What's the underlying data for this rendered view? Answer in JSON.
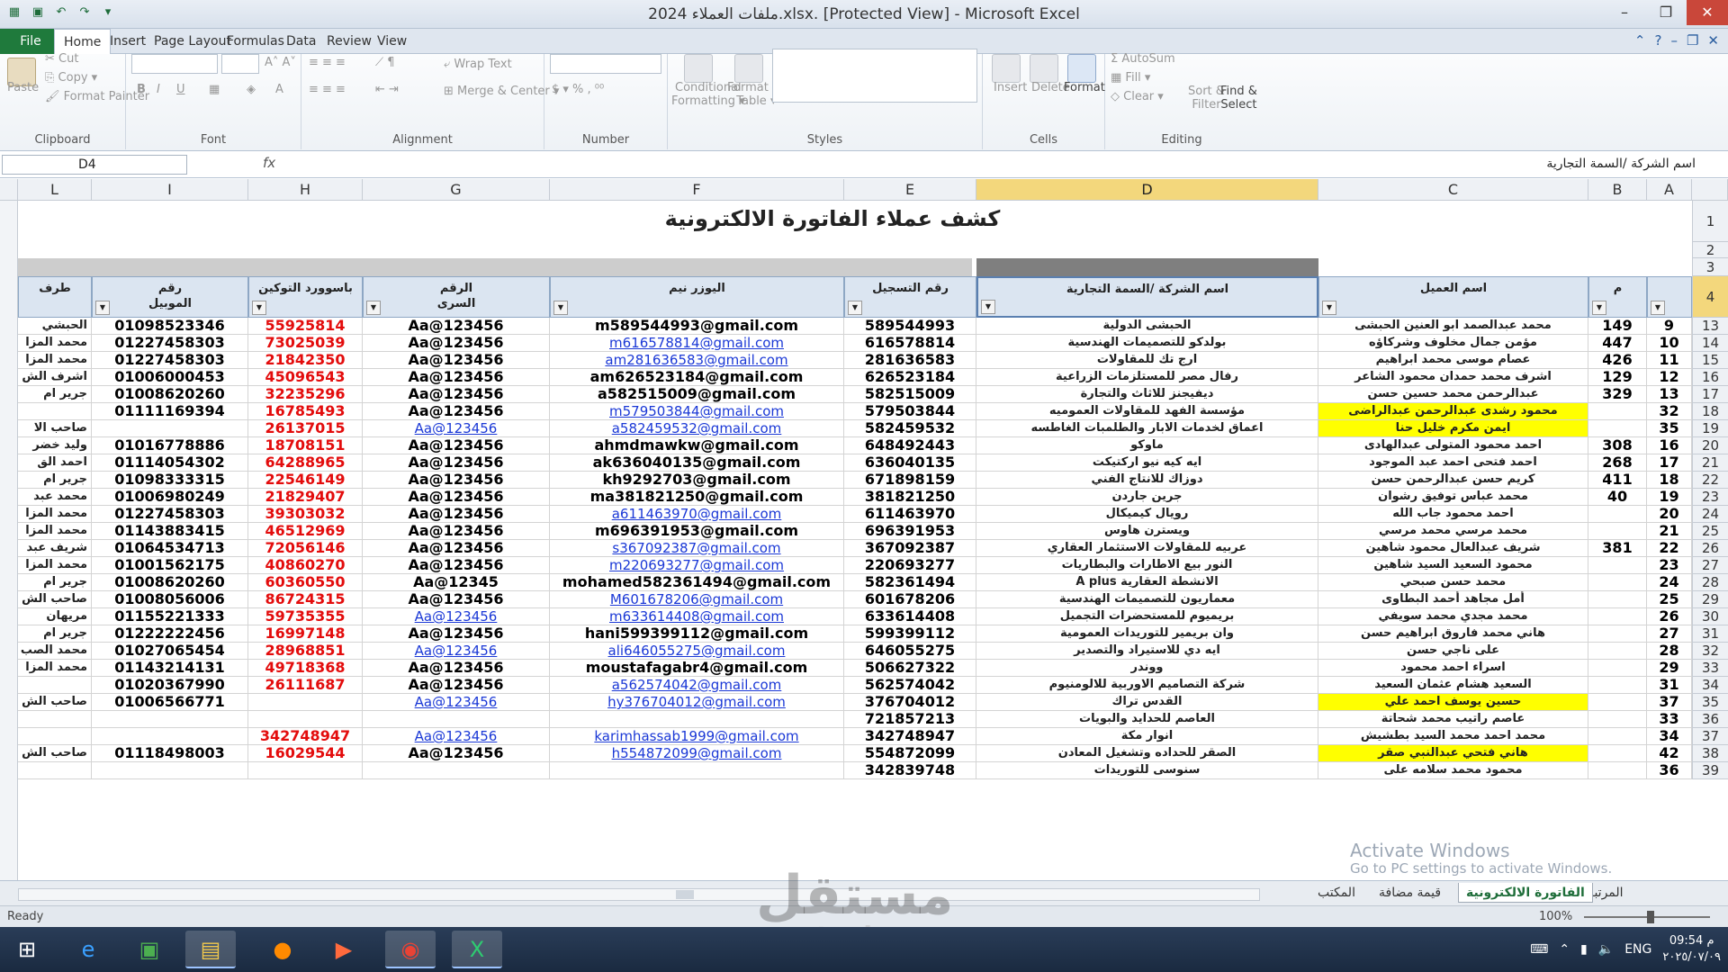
{
  "window": {
    "title": "ملفات العملاء 2024.xlsx.  [Protected View]  -  Microsoft Excel"
  },
  "tabs": [
    "File",
    "Home",
    "Insert",
    "Page Layout",
    "Formulas",
    "Data",
    "Review",
    "View"
  ],
  "ribbon": {
    "clipboard": {
      "label": "Clipboard",
      "paste": "Paste",
      "cut": "Cut",
      "copy": "Copy",
      "format_painter": "Format Painter"
    },
    "font": {
      "label": "Font"
    },
    "alignment": {
      "label": "Alignment",
      "wrap_text": "Wrap Text",
      "merge_center": "Merge & Center"
    },
    "number": {
      "label": "Number"
    },
    "styles": {
      "label": "Styles",
      "conditional": "Conditional",
      "formatting": "Formatting",
      "format_as": "Format as",
      "table": "Table"
    },
    "cells": {
      "label": "Cells",
      "insert": "Insert",
      "delete": "Delete",
      "format": "Format"
    },
    "editing": {
      "label": "Editing",
      "autosum": "AutoSum",
      "fill": "Fill",
      "clear": "Clear",
      "sort": "Sort &",
      "filter": "Filter",
      "find": "Find &",
      "select": "Select"
    }
  },
  "formula_bar": {
    "cell_ref": "D4",
    "fx": "fx",
    "content": "اسم الشركة /السمة التجارية"
  },
  "columns": [
    {
      "letter": "L",
      "sel": false
    },
    {
      "letter": "I",
      "sel": false
    },
    {
      "letter": "H",
      "sel": false
    },
    {
      "letter": "G",
      "sel": false
    },
    {
      "letter": "F",
      "sel": false
    },
    {
      "letter": "E",
      "sel": false
    },
    {
      "letter": "D",
      "sel": true
    },
    {
      "letter": "C",
      "sel": false
    },
    {
      "letter": "B",
      "sel": false
    },
    {
      "letter": "A",
      "sel": false
    }
  ],
  "sheet_title": "كشف عملاء الفاتورة الالكترونية",
  "headers": {
    "L": "طرف",
    "I": "رقم\nالموبيل",
    "H": "باسوورد التوكين",
    "G": "الرقم\nالسرى",
    "F": "اليوزر نيم",
    "E": "رقم التسجيل",
    "D": "اسم الشركة /السمة التجارية",
    "C": "اسم العميل",
    "B": "م"
  },
  "row_numbers": {
    "r1": "1",
    "r2": "2",
    "r3": "3",
    "r4": "4"
  },
  "rows": [
    {
      "rn": "13",
      "A": "9",
      "B": "149",
      "C": "محمد عبدالصمد ابو العنين الحبشى",
      "D": "الحبشى الدولية",
      "E": "589544993",
      "F": "m589544993@gmail.com",
      "Fl": false,
      "G": "Aa@123456",
      "Gl": false,
      "H": "55925814",
      "I": "01098523346",
      "L": "الحبشي",
      "Cy": false
    },
    {
      "rn": "14",
      "A": "10",
      "B": "447",
      "C": "مؤمن جمال مخلوف وشركاؤه",
      "D": "بولدكو للتصميمات الهندسية",
      "E": "616578814",
      "F": "m616578814@gmail.com",
      "Fl": true,
      "G": "Aa@123456",
      "Gl": false,
      "H": "73025039",
      "I": "01227458303",
      "L": "محمد المزا",
      "Cy": false
    },
    {
      "rn": "15",
      "A": "11",
      "B": "426",
      "C": "عصام موسى محمد ابراهيم",
      "D": "ارج تك للمقاولات",
      "E": "281636583",
      "F": "am281636583@gmail.com",
      "Fl": true,
      "G": "Aa@123456",
      "Gl": false,
      "H": "21842350",
      "I": "01227458303",
      "L": "محمد المزا",
      "Cy": false
    },
    {
      "rn": "16",
      "A": "12",
      "B": "129",
      "C": "اشرف محمد حمدان محمود الشاعر",
      "D": "رفال مصر للمستلزمات الزراعية",
      "E": "626523184",
      "F": "am626523184@gmail.com",
      "Fl": false,
      "G": "Aa@123456",
      "Gl": false,
      "H": "45096543",
      "I": "01006000453",
      "L": "اشرف الش",
      "Cy": false
    },
    {
      "rn": "17",
      "A": "13",
      "B": "329",
      "C": "عبدالرحمن محمد حسين حسن",
      "D": "ديفيجنز للاثاث والتجارة",
      "E": "582515009",
      "F": "a582515009@gmail.com",
      "Fl": false,
      "G": "Aa@123456",
      "Gl": false,
      "H": "32235296",
      "I": "01008620260",
      "L": "جرير ام",
      "Cy": false
    },
    {
      "rn": "18",
      "A": "32",
      "B": "",
      "C": "محمود رشدى عبدالرحمن عبدالراضى",
      "D": "مؤسسة الفهد للمقاولات العموميه",
      "E": "579503844",
      "F": "m579503844@gmail.com",
      "Fl": true,
      "G": "Aa@123456",
      "Gl": false,
      "H": "16785493",
      "I": "01111169394",
      "L": "",
      "Cy": true
    },
    {
      "rn": "19",
      "A": "35",
      "B": "",
      "C": "ايمن مكرم خليل حنا",
      "D": "اعماق لخدمات الابار والطلمبات الغاطسه",
      "E": "582459532",
      "F": "a582459532@gmail.com",
      "Fl": true,
      "G": "Aa@123456",
      "Gl": true,
      "H": "26137015",
      "I": "",
      "L": "صاحب الا",
      "Cy": true
    },
    {
      "rn": "20",
      "A": "16",
      "B": "308",
      "C": "احمد محمود المتولى عبدالهادى",
      "D": "ماوكو",
      "E": "648492443",
      "F": "ahmdmawkw@gmail.com",
      "Fl": false,
      "G": "Aa@123456",
      "Gl": false,
      "H": "18708151",
      "I": "01016778886",
      "L": "وليد خضر",
      "Cy": false
    },
    {
      "rn": "21",
      "A": "17",
      "B": "268",
      "C": "احمد فتحى احمد عبد الموجود",
      "D": "ايه كيه نيو اركتيكت",
      "E": "636040135",
      "F": "ak636040135@gmail.com",
      "Fl": false,
      "G": "Aa@123456",
      "Gl": false,
      "H": "64288965",
      "I": "01114054302",
      "L": "احمد الق",
      "Cy": false
    },
    {
      "rn": "22",
      "A": "18",
      "B": "411",
      "C": "كريم حسن عبدالرحمن حسن",
      "D": "دوزاك للانتاج الفني",
      "E": "671898159",
      "F": "kh9292703@gmail.com",
      "Fl": false,
      "G": "Aa@123456",
      "Gl": false,
      "H": "22546149",
      "I": "01098333315",
      "L": "جرير ام",
      "Cy": false
    },
    {
      "rn": "23",
      "A": "19",
      "B": "40",
      "C": "محمد عباس توفيق رشوان",
      "D": "جرين جاردن",
      "E": "381821250",
      "F": "ma381821250@gmail.com",
      "Fl": false,
      "G": "Aa@123456",
      "Gl": false,
      "H": "21829407",
      "I": "01006980249",
      "L": "محمد عبد",
      "Cy": false
    },
    {
      "rn": "24",
      "A": "20",
      "B": "",
      "C": "احمد محمود جاب الله",
      "D": "رويال كيميكال",
      "E": "611463970",
      "F": "a611463970@gmail.com",
      "Fl": true,
      "G": "Aa@123456",
      "Gl": false,
      "H": "39303032",
      "I": "01227458303",
      "L": "محمد المزا",
      "Cy": false
    },
    {
      "rn": "25",
      "A": "21",
      "B": "",
      "C": "محمد مرسي محمد مرسي",
      "D": "ويسترن هاوس",
      "E": "696391953",
      "F": "m696391953@gmail.com",
      "Fl": false,
      "G": "Aa@123456",
      "Gl": false,
      "H": "46512969",
      "I": "01143883415",
      "L": "محمد المزا",
      "Cy": false
    },
    {
      "rn": "26",
      "A": "22",
      "B": "381",
      "C": "شريف عبدالعال محمود شاهين",
      "D": "عربيه للمقاولات الاستثمار العقاري",
      "E": "367092387",
      "F": "s367092387@gmail.com",
      "Fl": true,
      "G": "Aa@123456",
      "Gl": false,
      "H": "72056146",
      "I": "01064534713",
      "L": "شريف عبد",
      "Cy": false
    },
    {
      "rn": "27",
      "A": "23",
      "B": "",
      "C": "محمود السعيد السيد شاهين",
      "D": "النور بيع الاطارات والبطاريات",
      "E": "220693277",
      "F": "m220693277@gmail.com",
      "Fl": true,
      "G": "Aa@123456",
      "Gl": false,
      "H": "40860270",
      "I": "01001562175",
      "L": "محمد المزا",
      "Cy": false
    },
    {
      "rn": "28",
      "A": "24",
      "B": "",
      "C": "محمد حسن صبحي",
      "D": "الانشطة العقارية A plus",
      "E": "582361494",
      "F": "mohamed582361494@gmail.com",
      "Fl": false,
      "G": "Aa@12345",
      "Gl": false,
      "H": "60360550",
      "I": "01008620260",
      "L": "جرير ام",
      "Cy": false
    },
    {
      "rn": "29",
      "A": "25",
      "B": "",
      "C": "أمل مجاهد أحمد البطاوى",
      "D": "معماريون للتصميمات الهندسية",
      "E": "601678206",
      "F": "M601678206@gmail.com",
      "Fl": true,
      "G": "Aa@123456",
      "Gl": false,
      "H": "86724315",
      "I": "01008056006",
      "L": "صاحب الش",
      "Cy": false
    },
    {
      "rn": "30",
      "A": "26",
      "B": "",
      "C": "محمد مجدي محمد سويفي",
      "D": "بريميوم للمستحضرات التجميل",
      "E": "633614408",
      "F": "m633614408@gmail.com",
      "Fl": true,
      "G": "Aa@123456",
      "Gl": true,
      "H": "59735355",
      "I": "01155221333",
      "L": "مريهان",
      "Cy": false
    },
    {
      "rn": "31",
      "A": "27",
      "B": "",
      "C": "هاني محمد فاروق ابراهيم حسن",
      "D": "وان بريمير للتوريدات العمومية",
      "E": "599399112",
      "F": "hani599399112@gmail.com",
      "Fl": false,
      "G": "Aa@123456",
      "Gl": false,
      "H": "16997148",
      "I": "01222222456",
      "L": "جرير ام",
      "Cy": false
    },
    {
      "rn": "32",
      "A": "28",
      "B": "",
      "C": "على ناجي حسن",
      "D": "ايه دي للاستيراد والتصدير",
      "E": "646055275",
      "F": "ali646055275@gmail.com",
      "Fl": true,
      "G": "Aa@123456",
      "Gl": true,
      "H": "28968851",
      "I": "01027065454",
      "L": "محمد الصب",
      "Cy": false
    },
    {
      "rn": "33",
      "A": "29",
      "B": "",
      "C": "اسراء احمد محمود",
      "D": "ووندر",
      "E": "506627322",
      "F": "moustafagabr4@gmail.com",
      "Fl": false,
      "G": "Aa@123456",
      "Gl": false,
      "H": "49718368",
      "I": "01143214131",
      "L": "محمد المزا",
      "Cy": false
    },
    {
      "rn": "34",
      "A": "31",
      "B": "",
      "C": "السعيد هشام عثمان السعيد",
      "D": "شركة التصاميم الاوربية للالومنيوم",
      "E": "562574042",
      "F": "a562574042@gmail.com",
      "Fl": true,
      "G": "Aa@123456",
      "Gl": false,
      "H": "26111687",
      "I": "01020367990",
      "L": "",
      "Cy": false
    },
    {
      "rn": "35",
      "A": "37",
      "B": "",
      "C": "حسين يوسف احمد علي",
      "D": "القدس تراك",
      "E": "376704012",
      "F": "hy376704012@gmail.com",
      "Fl": true,
      "G": "Aa@123456",
      "Gl": true,
      "H": "",
      "I": "01006566771",
      "L": "صاحب الش",
      "Cy": true
    },
    {
      "rn": "36",
      "A": "33",
      "B": "",
      "C": "عاصم راتيب محمد شحاتة",
      "D": "العاصم للحدايد والبويات",
      "E": "721857213",
      "F": "",
      "Fl": false,
      "G": "",
      "Gl": false,
      "H": "",
      "I": "",
      "L": "",
      "Cy": false
    },
    {
      "rn": "37",
      "A": "34",
      "B": "",
      "C": "محمد احمد محمد السيد بطشيش",
      "D": "انوار مكة",
      "E": "342748947",
      "F": "karimhassab1999@gmail.com",
      "Fl": true,
      "G": "Aa@123456",
      "Gl": true,
      "H": "342748947",
      "I": "",
      "L": "",
      "Cy": false
    },
    {
      "rn": "38",
      "A": "42",
      "B": "",
      "C": "هاني فتحي عبدالنبي صقر",
      "D": "الصقر للحداده وتشغيل المعادن",
      "E": "554872099",
      "F": "h554872099@gmail.com",
      "Fl": true,
      "G": "Aa@123456",
      "Gl": false,
      "H": "16029544",
      "I": "01118498003",
      "L": "صاحب الش",
      "Cy": true
    },
    {
      "rn": "39",
      "A": "36",
      "B": "",
      "C": "محمود محمد سلامه على",
      "D": "سنوسى للتوريدات",
      "E": "342839748",
      "F": "",
      "Fl": false,
      "G": "",
      "Gl": false,
      "H": "",
      "I": "",
      "L": "",
      "Cy": false
    }
  ],
  "sheet_tabs": [
    "المرتبات",
    "الفاتورة الالكترونية",
    "قيمة مضافة",
    "المكتب"
  ],
  "status": {
    "ready": "Ready",
    "zoom": "100%"
  },
  "watermark": {
    "line1": "Activate Windows",
    "line2": "Go to PC settings to activate Windows."
  },
  "logo": {
    "ar": "مستقل",
    "en": "mostaql.com"
  },
  "clock": {
    "time": "09:54 م",
    "date": "٢٠٢٥/٠٧/٠٩",
    "lang": "ENG"
  }
}
